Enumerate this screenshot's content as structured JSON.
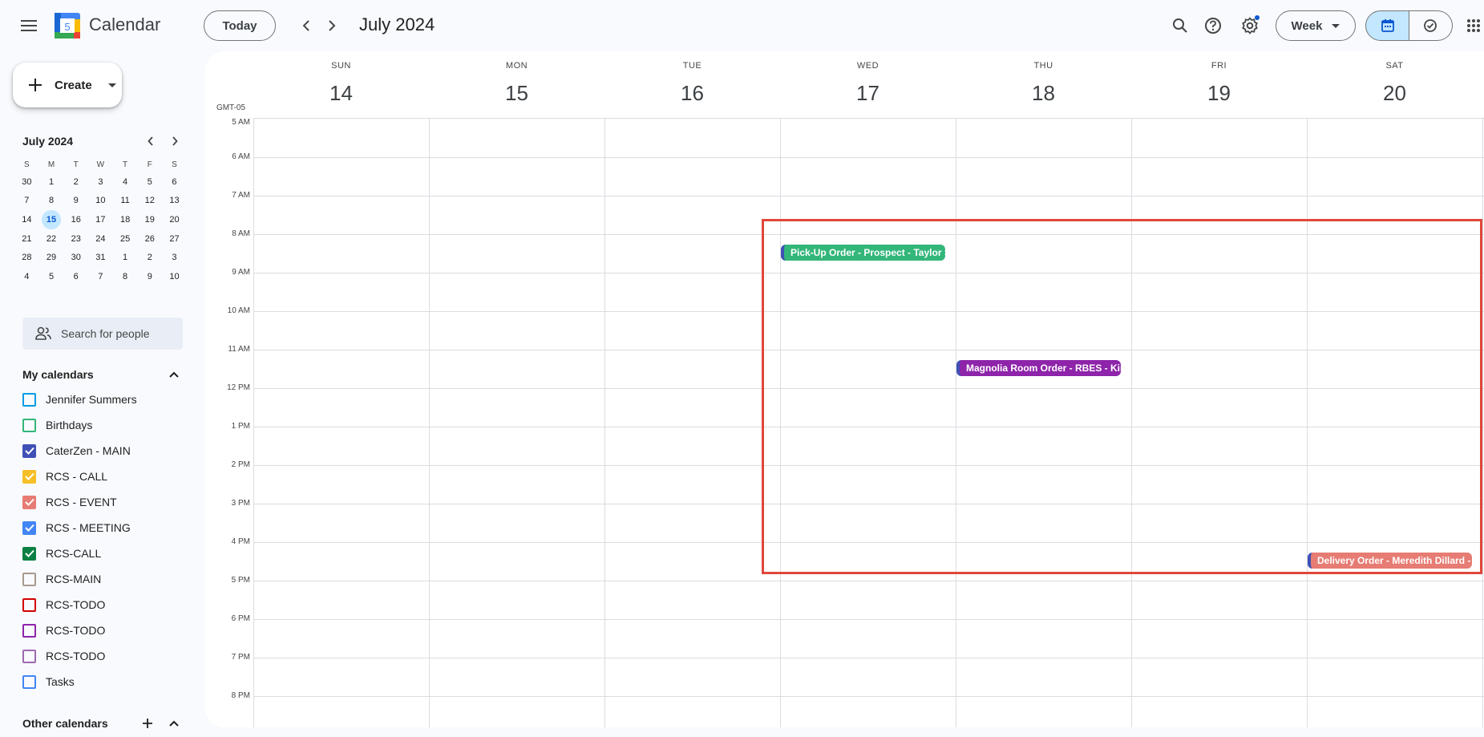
{
  "app": {
    "title": "Calendar",
    "logo_day": "5"
  },
  "header": {
    "today_label": "Today",
    "period_title": "July 2024",
    "view_label": "Week"
  },
  "sidebar": {
    "create_label": "Create",
    "mini_cal": {
      "title": "July 2024",
      "dow": [
        "S",
        "M",
        "T",
        "W",
        "T",
        "F",
        "S"
      ],
      "weeks": [
        [
          "30",
          "1",
          "2",
          "3",
          "4",
          "5",
          "6"
        ],
        [
          "7",
          "8",
          "9",
          "10",
          "11",
          "12",
          "13"
        ],
        [
          "14",
          "15",
          "16",
          "17",
          "18",
          "19",
          "20"
        ],
        [
          "21",
          "22",
          "23",
          "24",
          "25",
          "26",
          "27"
        ],
        [
          "28",
          "29",
          "30",
          "31",
          "1",
          "2",
          "3"
        ],
        [
          "4",
          "5",
          "6",
          "7",
          "8",
          "9",
          "10"
        ]
      ],
      "today": "15"
    },
    "people_search_placeholder": "Search for people",
    "my_calendars_label": "My calendars",
    "my_calendars": [
      {
        "name": "Jennifer Summers",
        "color": "#039be5",
        "checked": false
      },
      {
        "name": "Birthdays",
        "color": "#33b679",
        "checked": false
      },
      {
        "name": "CaterZen - MAIN",
        "color": "#3f51b5",
        "checked": true
      },
      {
        "name": "RCS - CALL",
        "color": "#f6bf26",
        "checked": true
      },
      {
        "name": "RCS - EVENT",
        "color": "#e67c73",
        "checked": true
      },
      {
        "name": "RCS - MEETING",
        "color": "#4285f4",
        "checked": true
      },
      {
        "name": "RCS-CALL",
        "color": "#0b8043",
        "checked": true
      },
      {
        "name": "RCS-MAIN",
        "color": "#a79b8e",
        "checked": false
      },
      {
        "name": "RCS-TODO",
        "color": "#d50000",
        "checked": false
      },
      {
        "name": "RCS-TODO",
        "color": "#8e24aa",
        "checked": false
      },
      {
        "name": "RCS-TODO",
        "color": "#9e69af",
        "checked": false
      },
      {
        "name": "Tasks",
        "color": "#4285f4",
        "checked": false
      }
    ],
    "other_calendars_label": "Other calendars"
  },
  "week": {
    "timezone": "GMT-05",
    "days": [
      {
        "dow": "SUN",
        "num": "14"
      },
      {
        "dow": "MON",
        "num": "15"
      },
      {
        "dow": "TUE",
        "num": "16"
      },
      {
        "dow": "WED",
        "num": "17"
      },
      {
        "dow": "THU",
        "num": "18"
      },
      {
        "dow": "FRI",
        "num": "19"
      },
      {
        "dow": "SAT",
        "num": "20"
      }
    ],
    "hours": [
      "5 AM",
      "6 AM",
      "7 AM",
      "8 AM",
      "9 AM",
      "10 AM",
      "11 AM",
      "12 PM",
      "1 PM",
      "2 PM",
      "3 PM",
      "4 PM",
      "5 PM",
      "6 PM",
      "7 PM",
      "8 PM"
    ]
  },
  "events": [
    {
      "title": "Pick-Up Order - Prospect - Taylor Smith",
      "day": "WED",
      "start": "8:15 AM",
      "color": "#33b679"
    },
    {
      "title": "Magnolia Room Order - RBES - Kim",
      "day": "THU",
      "start": "11:15 AM",
      "color": "#8e24aa"
    },
    {
      "title": "Delivery Order - Meredith Dillard - ",
      "day": "SAT",
      "start": "4:15 PM",
      "color": "#e67c73"
    }
  ]
}
